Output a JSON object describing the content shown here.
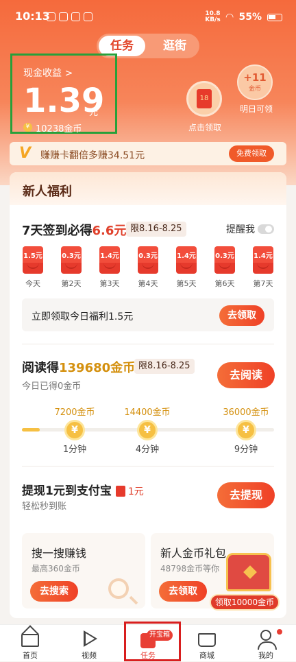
{
  "status": {
    "time": "10:13",
    "speed": "10.8",
    "speed_unit": "KB/s",
    "battery": "55%"
  },
  "top_tabs": [
    "任务",
    "逛街"
  ],
  "cash": {
    "title": "现金收益 >",
    "amount": "1.39",
    "unit": "元",
    "coins": "10238金币"
  },
  "redpacket": {
    "label": "点击领取",
    "env_text": "18"
  },
  "tomorrow": {
    "plus": "+11",
    "unit": "金币",
    "label": "明日可领"
  },
  "banner": {
    "icon": "V",
    "text": "赚赚卡翻倍多赚34.51元",
    "button": "免费领取"
  },
  "newbie": {
    "title": "新人福利"
  },
  "checkin": {
    "title_prefix": "7天签到必得",
    "title_highlight": "6.6元",
    "date_tag": "限8.16-8.25",
    "remind": "提醒我",
    "days": [
      {
        "amount": "1.5元",
        "label": "今天"
      },
      {
        "amount": "0.3元",
        "label": "第2天"
      },
      {
        "amount": "1.4元",
        "label": "第3天"
      },
      {
        "amount": "0.3元",
        "label": "第4天"
      },
      {
        "amount": "1.4元",
        "label": "第5天"
      },
      {
        "amount": "0.3元",
        "label": "第6天"
      },
      {
        "amount": "1.4元",
        "label": "第7天"
      }
    ],
    "claim_text": "立即领取今日福利1.5元",
    "claim_button": "去领取"
  },
  "reading": {
    "title_prefix": "阅读得",
    "title_highlight": "139680金币",
    "date_tag": "限8.16-8.25",
    "sub": "今日已得0金币",
    "button": "去阅读",
    "progress_fraction": 0.07,
    "milestones": [
      {
        "coins": "7200金币",
        "time": "1分钟"
      },
      {
        "coins": "14400金币",
        "time": "4分钟"
      },
      {
        "coins": "36000金币",
        "time": "9分钟"
      }
    ],
    "coin_symbol": "¥"
  },
  "withdraw": {
    "title": "提现1元到支付宝",
    "tag": "1元",
    "sub": "轻松秒到账",
    "button": "去提现"
  },
  "search_box": {
    "title": "搜一搜赚钱",
    "sub": "最高360金币",
    "button": "去搜索"
  },
  "gift_box": {
    "title": "新人金币礼包",
    "sub": "48798金币等你",
    "button": "去领取",
    "chest_label": "领取10000金币"
  },
  "nav": [
    {
      "label": "首页",
      "icon": "home-icon"
    },
    {
      "label": "视频",
      "icon": "play-icon"
    },
    {
      "label": "任务",
      "icon": "task-icon",
      "badge": "开宝箱"
    },
    {
      "label": "商城",
      "icon": "shop-bag-icon"
    },
    {
      "label": "我的",
      "icon": "user-icon"
    }
  ],
  "colors": {
    "accent": "#f05a2a",
    "gold": "#d4900e",
    "highlight_box": "#27a03a",
    "nav_highlight": "#d81e1e"
  }
}
